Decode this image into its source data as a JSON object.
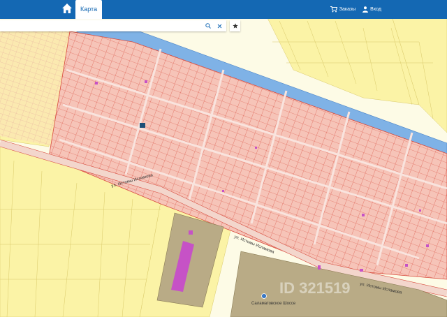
{
  "header": {
    "map_tab": "Карта",
    "orders_label": "Заказы",
    "login_label": "Вход"
  },
  "search": {
    "value": ""
  },
  "map": {
    "street_label_1": "ул. Истомы Исламова",
    "street_label_2": "ул. Истомы Исламова",
    "poi_right_label": "Саламатовское Шоссе",
    "watermark": "ID 321519",
    "icons": [
      "home-icon",
      "cart-icon",
      "user-icon",
      "search-icon",
      "clear-icon",
      "star-icon",
      "poi-marker-icon"
    ]
  },
  "colors": {
    "header_bg": "#1468b3",
    "parcel_fill": "#f6c4b8",
    "parcel_border": "#d84a3c",
    "zone_yellow": "#fbf3a6",
    "river": "#7fb2e6",
    "industrial": "#b9ab86",
    "building": "#c652c6"
  }
}
